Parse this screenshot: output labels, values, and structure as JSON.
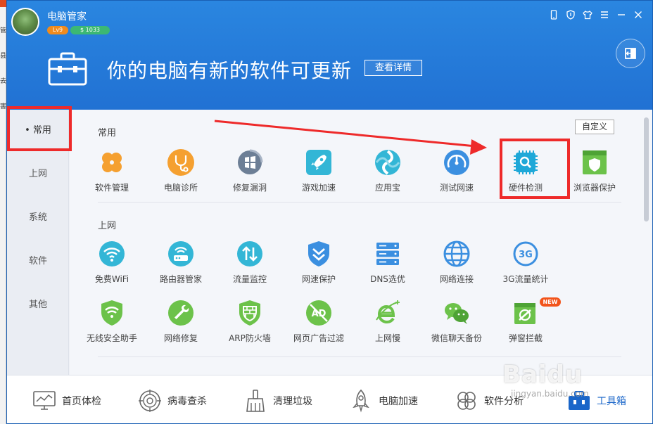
{
  "app": {
    "name": "电脑管家",
    "level": "Lv9",
    "coins": "$ 1033"
  },
  "banner": {
    "text": "你的电脑有新的软件可更新",
    "detail_label": "查看详情"
  },
  "left_strip": {
    "chars": [
      "管",
      "县",
      "去",
      "害"
    ]
  },
  "sidebar": {
    "items": [
      {
        "label": "• 常用"
      },
      {
        "label": "上网"
      },
      {
        "label": "系统"
      },
      {
        "label": "软件"
      },
      {
        "label": "其他"
      }
    ]
  },
  "sections": {
    "common": {
      "title": "常用",
      "custom_label": "自定义",
      "tools": [
        "软件管理",
        "电脑诊所",
        "修复漏洞",
        "游戏加速",
        "应用宝",
        "测试网速",
        "硬件检测",
        "浏览器保护"
      ]
    },
    "internet": {
      "title": "上网",
      "tools_row1": [
        "免费WiFi",
        "路由器管家",
        "流量监控",
        "网速保护",
        "DNS选优",
        "网络连接",
        "3G流量统计"
      ],
      "tools_row2": [
        "无线安全助手",
        "网络修复",
        "ARP防火墙",
        "网页广告过滤",
        "上网慢",
        "微信聊天备份",
        "弹窗拦截"
      ],
      "new_badge": "NEW",
      "icon_text": {
        "g3": "3G",
        "ad": "AD"
      }
    }
  },
  "bottom_bar": {
    "items": [
      "首页体检",
      "病毒查杀",
      "清理垃圾",
      "电脑加速",
      "软件分析",
      "工具箱"
    ]
  },
  "watermark": {
    "brand": "Baidu",
    "sub": "jingyan.baidu.com"
  },
  "colors": {
    "header_blue": "#2171d3",
    "highlight_red": "#ee2a2a",
    "orange": "#f5a030",
    "teal": "#33b6d6",
    "green": "#6cc24a"
  }
}
